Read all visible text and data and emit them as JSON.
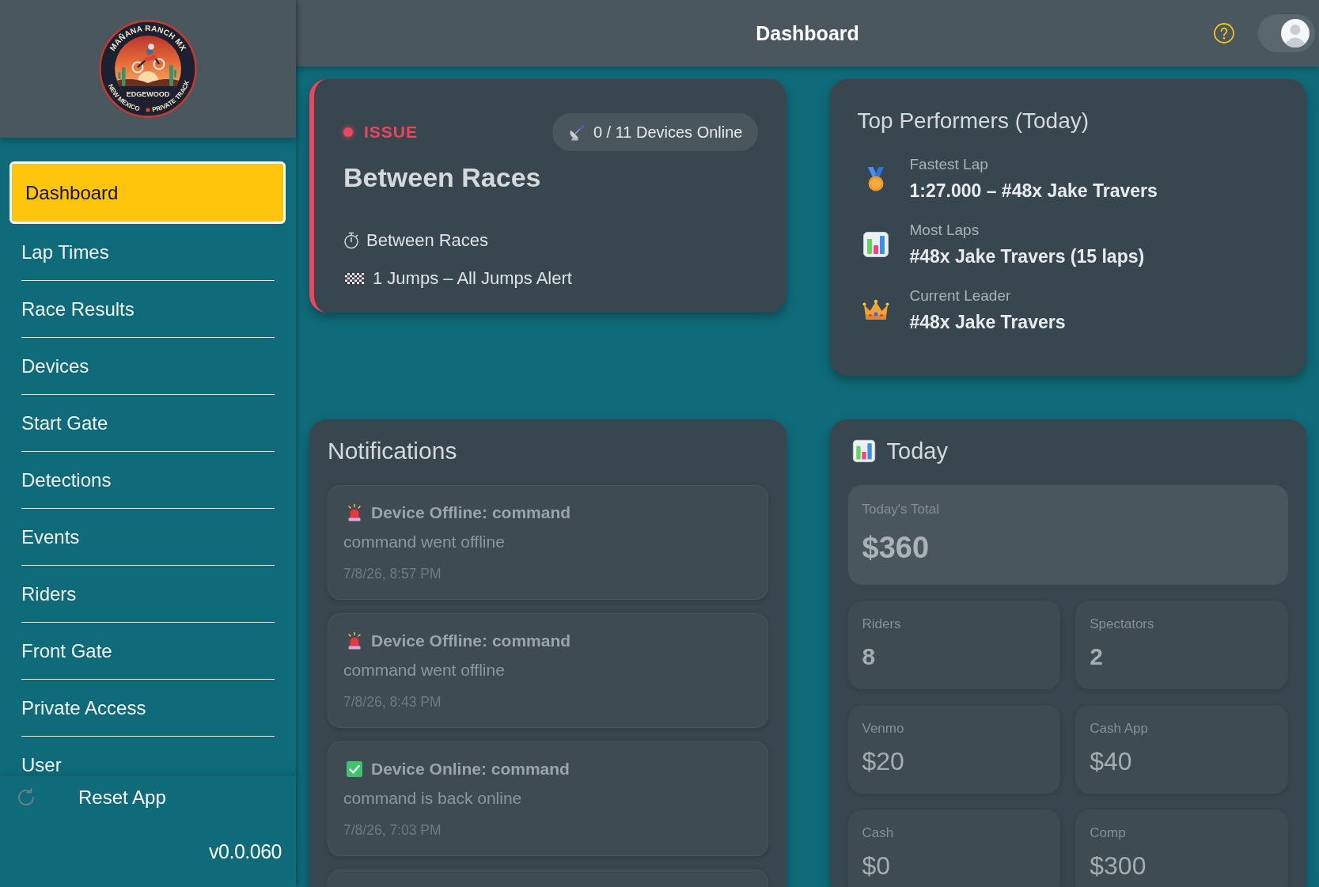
{
  "logo": {
    "title": "MAÑANA RANCH MX",
    "place": "EDGEWOOD",
    "left_caption": "NEW MEXICO",
    "right_caption": "PRIVATE TRACK"
  },
  "sidebar": {
    "items": [
      {
        "label": "Dashboard",
        "selected": true
      },
      {
        "label": "Lap Times",
        "selected": false
      },
      {
        "label": "Race Results",
        "selected": false
      },
      {
        "label": "Devices",
        "selected": false
      },
      {
        "label": "Start Gate",
        "selected": false
      },
      {
        "label": "Detections",
        "selected": false
      },
      {
        "label": "Events",
        "selected": false
      },
      {
        "label": "Riders",
        "selected": false
      },
      {
        "label": "Front Gate",
        "selected": false
      },
      {
        "label": "Private Access",
        "selected": false
      },
      {
        "label": "User",
        "selected": false
      }
    ],
    "reset_button": "Reset App",
    "version": "v0.0.060"
  },
  "top_bar": {
    "title": "Dashboard",
    "profile_toggle": {
      "on": true
    }
  },
  "status_card": {
    "status": {
      "kind": "issue",
      "label": "ISSUE"
    },
    "devices": "0 / 11 Devices Online",
    "title": "Between Races",
    "details": [
      {
        "kind": "timer",
        "text": "Between Races"
      },
      {
        "kind": "flag",
        "text": "1 Jumps – All Jumps Alert"
      }
    ]
  },
  "top_performers": {
    "title": "Top Performers (Today)",
    "rows": [
      {
        "kind": "medal",
        "label": "Fastest Lap",
        "value": "1:27.000 – #48x Jake Travers"
      },
      {
        "kind": "chart",
        "label": "Most Laps",
        "value": "#48x Jake Travers (15 laps)"
      },
      {
        "kind": "crown",
        "label": "Current Leader",
        "value": "#48x Jake Travers"
      }
    ]
  },
  "notifications": {
    "title": "Notifications",
    "items": [
      {
        "kind": "offline",
        "title": "Device Offline: command",
        "message": "command went offline",
        "time": "7/8/26, 8:57 PM"
      },
      {
        "kind": "offline",
        "title": "Device Offline: command",
        "message": "command went offline",
        "time": "7/8/26, 8:43 PM"
      },
      {
        "kind": "online",
        "title": "Device Online: command",
        "message": "command is back online",
        "time": "7/8/26, 7:03 PM"
      }
    ],
    "more_below": true
  },
  "today": {
    "title": "Today",
    "total": {
      "label": "Today's Total",
      "value": "$360"
    },
    "tiles": [
      {
        "kind": "count",
        "label": "Riders",
        "value": "8"
      },
      {
        "kind": "count",
        "label": "Spectators",
        "value": "2"
      },
      {
        "kind": "amount",
        "label": "Venmo",
        "value": "$20"
      },
      {
        "kind": "amount",
        "label": "Cash App",
        "value": "$40"
      },
      {
        "kind": "amount",
        "label": "Cash",
        "value": "$0"
      },
      {
        "kind": "amount",
        "label": "Comp",
        "value": "$300"
      }
    ]
  }
}
